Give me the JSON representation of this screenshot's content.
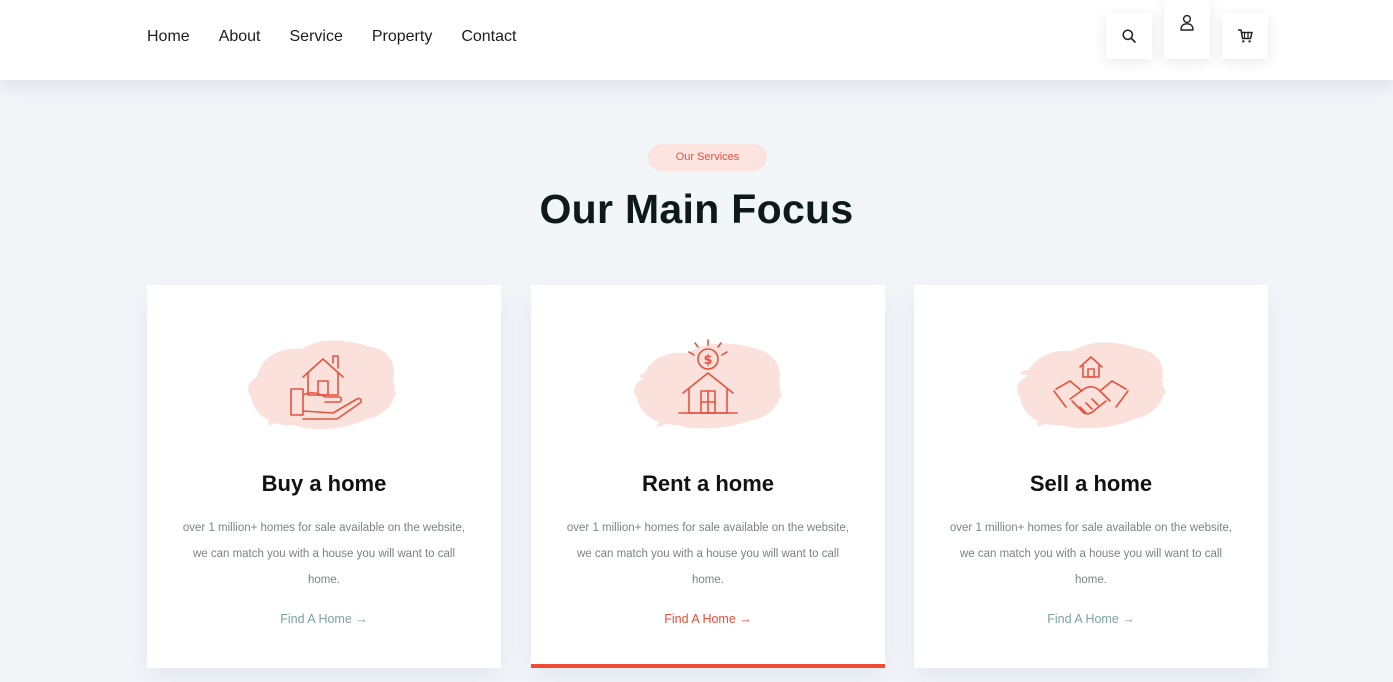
{
  "nav": {
    "items": [
      "Home",
      "About",
      "Service",
      "Property",
      "Contact"
    ]
  },
  "header_icons": [
    "search-icon",
    "user-icon",
    "cart-icon"
  ],
  "section": {
    "badge": "Our Services",
    "title": "Our Main Focus"
  },
  "cards": [
    {
      "title": "Buy a home",
      "description": "over 1 million+ homes for sale available on the website, we can match you with a house you will want to call home.",
      "link": "Find A Home →",
      "icon": "house-in-hand-icon",
      "active": false
    },
    {
      "title": "Rent a home",
      "description": "over 1 million+ homes for sale available on the website, we can match you with a house you will want to call home.",
      "link": "Find A Home →",
      "icon": "house-dollar-icon",
      "active": true
    },
    {
      "title": "Sell a home",
      "description": "over 1 million+ homes for sale available on the website, we can match you with a house you will want to call home.",
      "link": "Find A Home →",
      "icon": "handshake-house-icon",
      "active": false
    }
  ],
  "colors": {
    "accent": "#f04c35",
    "badge_bg": "#fbe3df",
    "page_bg": "#f3f6f9",
    "title": "#0e1a1a",
    "link_muted": "#7fa3a3"
  }
}
